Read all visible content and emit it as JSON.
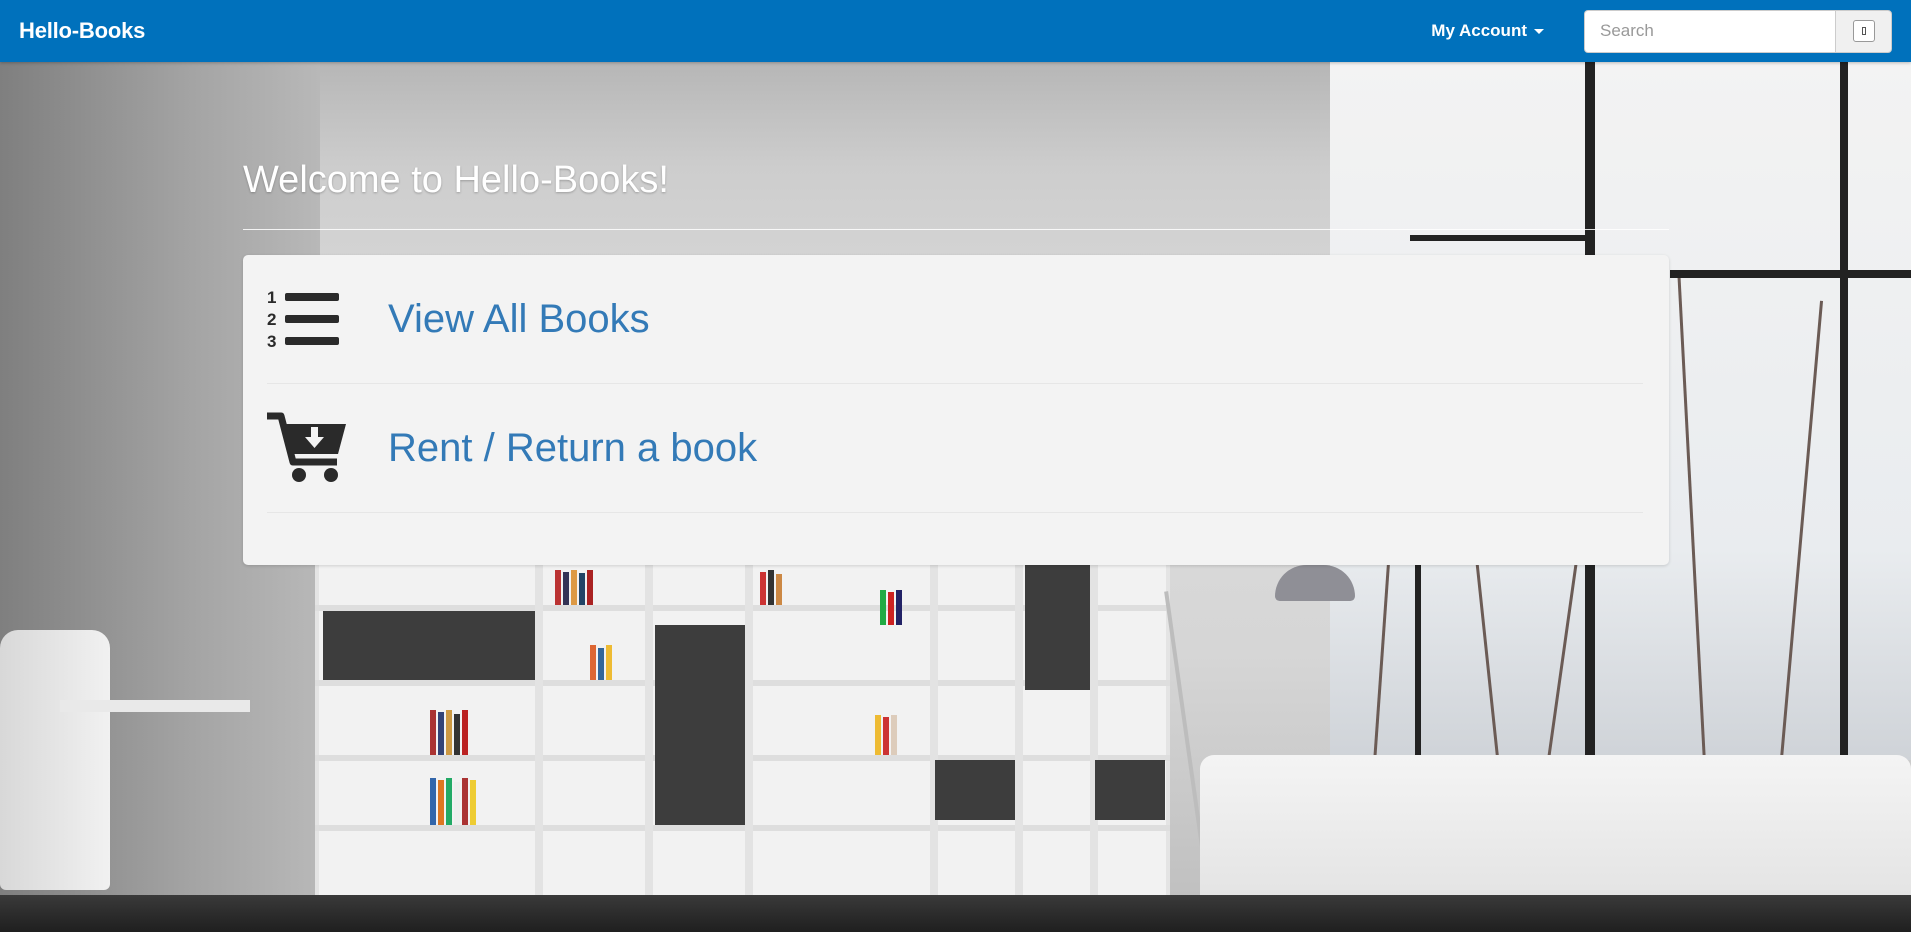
{
  "navbar": {
    "brand": "Hello-Books",
    "account_label": "My Account",
    "search_placeholder": "Search",
    "background_color": "#0071bc"
  },
  "main": {
    "title": "Welcome to Hello-Books!",
    "menu_items": [
      {
        "label": "View All Books",
        "icon": "numbered-list-icon"
      },
      {
        "label": "Rent / Return a book",
        "icon": "cart-download-icon"
      }
    ],
    "link_color": "#337ab7"
  }
}
